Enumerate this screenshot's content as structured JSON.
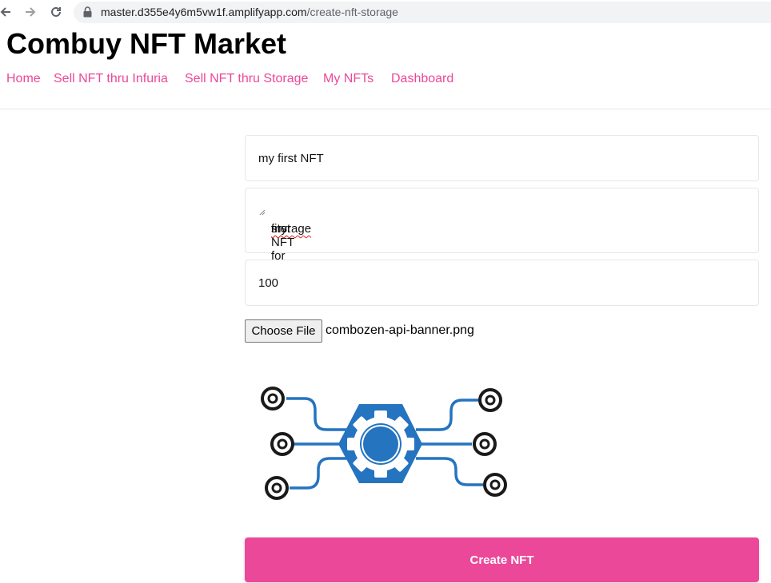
{
  "browser": {
    "url_host": "master.d355e4y6m5vw1f.amplifyapp.com",
    "url_path": "/create-nft-storage"
  },
  "site": {
    "title": "Combuy NFT Market"
  },
  "nav": {
    "items": [
      {
        "label": "Home"
      },
      {
        "label": "Sell NFT thru Infuria"
      },
      {
        "label": "Sell NFT thru Storage"
      },
      {
        "label": "My NFTs"
      },
      {
        "label": "Dashboard"
      }
    ]
  },
  "form": {
    "name_value": "my first NFT",
    "description_prefix": "my",
    "description_middle": " first NFT for ",
    "description_suffix": "storage",
    "price_value": "100",
    "choose_file_label": "Choose File",
    "file_name": "combozen-api-banner.png",
    "submit_label": "Create NFT"
  },
  "colors": {
    "accent": "#ec4899",
    "image_blue": "#2474c0",
    "image_dark": "#1a1a1a"
  }
}
